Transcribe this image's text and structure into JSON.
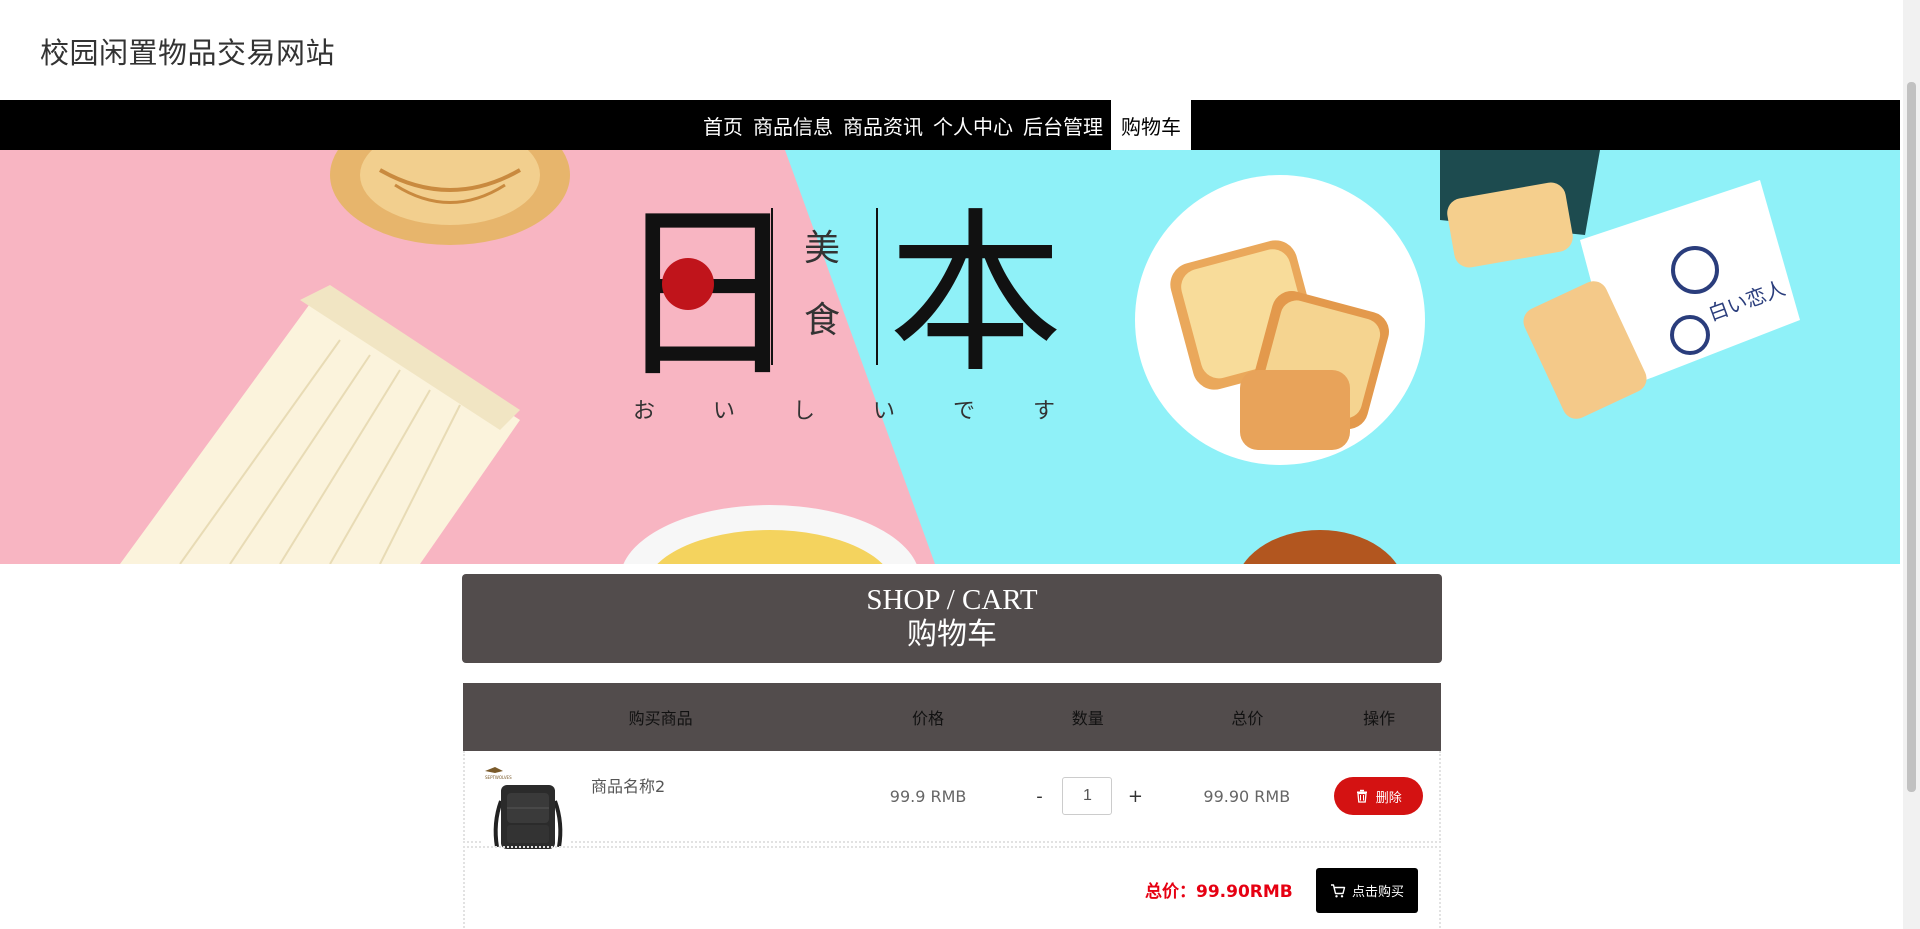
{
  "site": {
    "title": "校园闲置物品交易网站"
  },
  "nav": {
    "items": [
      "首页",
      "商品信息",
      "商品资讯",
      "个人中心",
      "后台管理",
      "购物车"
    ],
    "active": "购物车"
  },
  "banner": {
    "big_left": "日",
    "big_right": "本",
    "vertical": [
      "美",
      "食"
    ],
    "kana": [
      "お",
      "い",
      "し",
      "い",
      "で",
      "す"
    ],
    "package_text": "白い恋人",
    "colors": {
      "pink": "#f8b5c2",
      "cyan": "#8ff1f8",
      "red_dot": "#c0141b"
    }
  },
  "cart": {
    "title_en": "SHOP / CART",
    "title_zh": "购物车",
    "columns": [
      "购买商品",
      "价格",
      "数量",
      "总价",
      "操作"
    ],
    "items": [
      {
        "name": "商品名称2",
        "price": "99.9 RMB",
        "qty": "1",
        "total": "99.90 RMB",
        "delete_label": "删除"
      }
    ],
    "qty_minus": "-",
    "qty_plus": "+",
    "summary": {
      "total_text": "总价：99.90RMB",
      "buy_label": "点击购买"
    }
  },
  "colors": {
    "header_bar": "#524c4c",
    "nav_bg": "#000000",
    "danger": "#d41212",
    "total_red": "#e60012"
  }
}
